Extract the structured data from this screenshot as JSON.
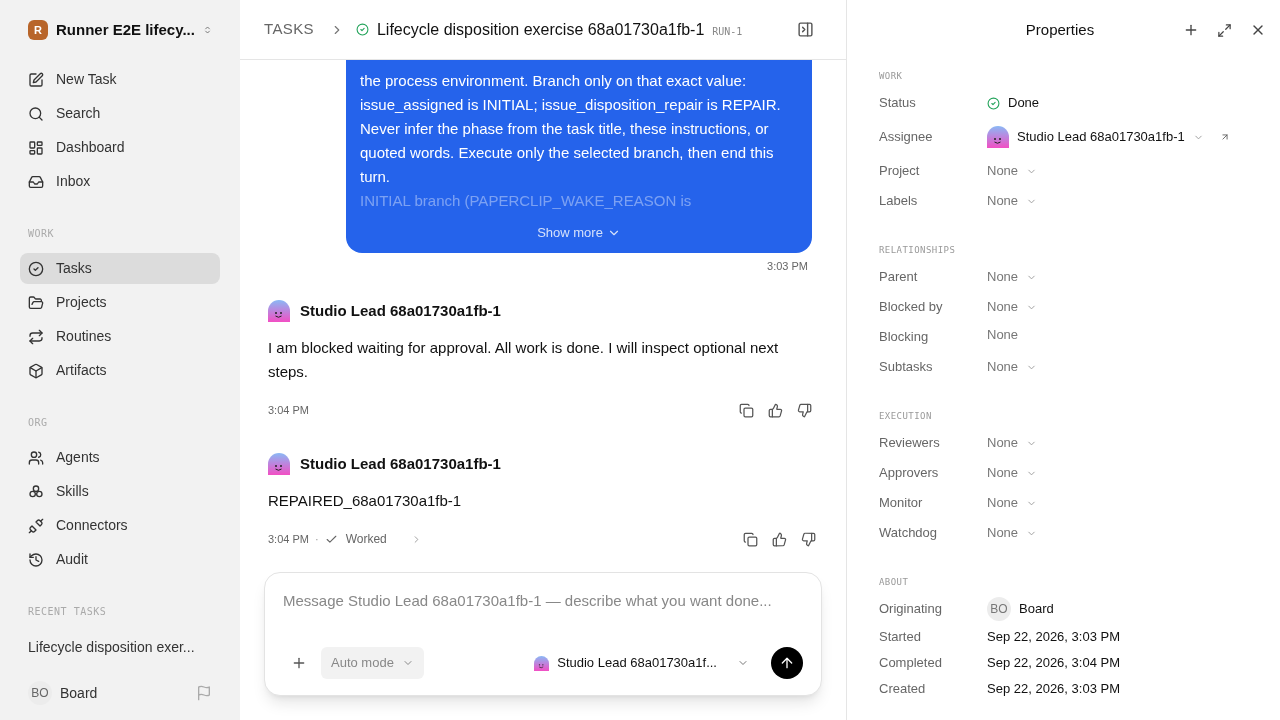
{
  "workspace": {
    "initial": "R",
    "name": "Runner E2E lifecy..."
  },
  "sidebar": {
    "top_items": [
      {
        "label": "New Task",
        "selected": false
      },
      {
        "label": "Search",
        "selected": false
      },
      {
        "label": "Dashboard",
        "selected": false
      },
      {
        "label": "Inbox",
        "selected": false
      }
    ],
    "sections": [
      {
        "heading": "WORK",
        "items": [
          {
            "label": "Tasks",
            "selected": true
          },
          {
            "label": "Projects",
            "selected": false
          },
          {
            "label": "Routines",
            "selected": false
          },
          {
            "label": "Artifacts",
            "selected": false
          }
        ]
      },
      {
        "heading": "ORG",
        "items": [
          {
            "label": "Agents",
            "selected": false
          },
          {
            "label": "Skills",
            "selected": false
          },
          {
            "label": "Connectors",
            "selected": false
          },
          {
            "label": "Audit",
            "selected": false
          }
        ]
      }
    ],
    "recent": {
      "heading": "RECENT TASKS",
      "items": [
        "Lifecycle disposition exer..."
      ]
    },
    "user": {
      "initials": "BO",
      "name": "Board"
    }
  },
  "header": {
    "breadcrumb": "TASKS",
    "title": "Lifecycle disposition exercise 68a01730a1fb-1",
    "run": "RUN-1",
    "done": true
  },
  "messages": [
    {
      "kind": "user",
      "text": "the process environment. Branch only on that exact value: issue_assigned is INITIAL; issue_disposition_repair is REPAIR. Never infer the phase from the task title, these instructions, or quoted words. Execute only the selected branch, then end this turn.",
      "faded_text": "INITIAL branch (PAPERCLIP_WAKE_REASON is",
      "show_more": "Show more",
      "time": "3:03 PM"
    },
    {
      "kind": "agent",
      "author": "Studio Lead 68a01730a1fb-1",
      "text": "I am blocked waiting for approval. All work is done. I will inspect optional next steps.",
      "time": "3:04 PM"
    },
    {
      "kind": "agent",
      "author": "Studio Lead 68a01730a1fb-1",
      "text": "REPAIRED_68a01730a1fb-1",
      "time": "3:04 PM",
      "separator": "·",
      "worked": "Worked"
    }
  ],
  "composer": {
    "placeholder": "Message Studio Lead 68a01730a1fb-1 — describe what you want done...",
    "mode": "Auto mode",
    "agent": "Studio Lead 68a01730a1f..."
  },
  "properties": {
    "title": "Properties",
    "sections": [
      {
        "heading": "WORK",
        "rows": [
          {
            "label": "Status",
            "kind": "status",
            "value": "Done"
          },
          {
            "label": "Assignee",
            "kind": "agent",
            "value": "Studio Lead 68a01730a1fb-1"
          },
          {
            "label": "Project",
            "kind": "select",
            "value": "None"
          },
          {
            "label": "Labels",
            "kind": "select",
            "value": "None"
          }
        ]
      },
      {
        "heading": "RELATIONSHIPS",
        "rows": [
          {
            "label": "Parent",
            "kind": "select",
            "value": "None"
          },
          {
            "label": "Blocked by",
            "kind": "select",
            "value": "None"
          },
          {
            "label": "Blocking",
            "kind": "plain",
            "value": "None"
          },
          {
            "label": "Subtasks",
            "kind": "select",
            "value": "None"
          }
        ]
      },
      {
        "heading": "EXECUTION",
        "rows": [
          {
            "label": "Reviewers",
            "kind": "select",
            "value": "None"
          },
          {
            "label": "Approvers",
            "kind": "select",
            "value": "None"
          },
          {
            "label": "Monitor",
            "kind": "select",
            "value": "None"
          },
          {
            "label": "Watchdog",
            "kind": "select",
            "value": "None"
          }
        ]
      },
      {
        "heading": "ABOUT",
        "rows": [
          {
            "label": "Originating",
            "kind": "user",
            "initials": "BO",
            "value": "Board"
          },
          {
            "label": "Started",
            "kind": "date",
            "value": "Sep 22, 2026, 3:03 PM"
          },
          {
            "label": "Completed",
            "kind": "date",
            "value": "Sep 22, 2026, 3:04 PM"
          },
          {
            "label": "Created",
            "kind": "date",
            "value": "Sep 22, 2026, 3:03 PM"
          }
        ]
      }
    ]
  }
}
